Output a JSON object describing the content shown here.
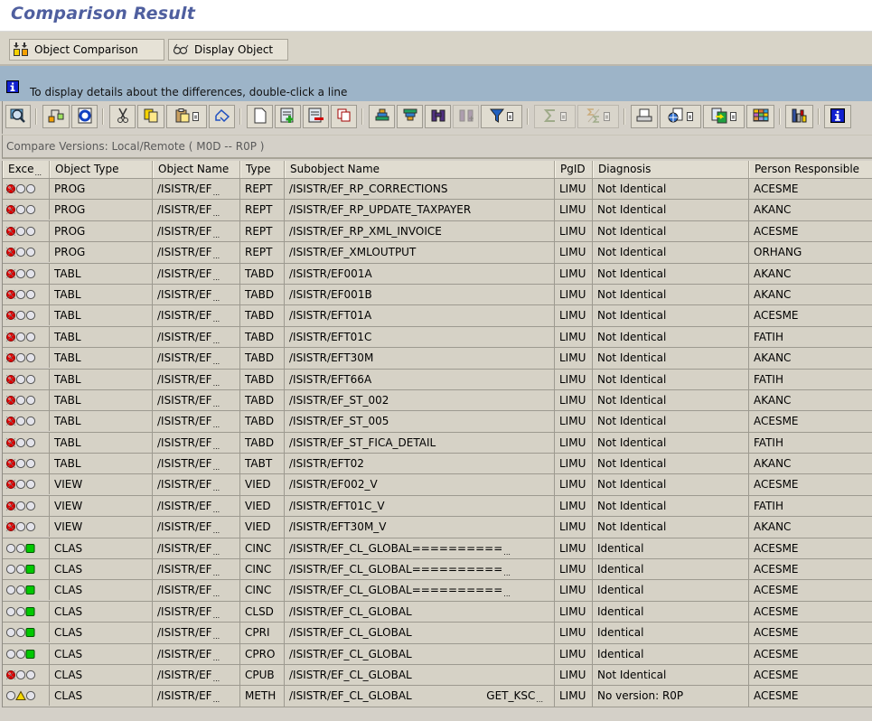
{
  "window": {
    "title": "Comparison Result"
  },
  "app_toolbar": {
    "buttons": [
      {
        "label": "Object Comparison",
        "icon": "object-comparison-icon"
      },
      {
        "label": "Display Object",
        "icon": "glasses-icon"
      }
    ]
  },
  "message": {
    "icon": "info-icon",
    "text": "To display details about the differences, double-click a line"
  },
  "alv_toolbar": {
    "buttons": [
      {
        "name": "details",
        "icon": "magnifier-icon",
        "enabled": true
      },
      {
        "name": "hierarchy",
        "icon": "hierarchy-icon",
        "enabled": true
      },
      {
        "name": "refresh",
        "icon": "refresh-icon",
        "enabled": true
      },
      {
        "name": "cut",
        "icon": "scissors-icon",
        "enabled": true
      },
      {
        "name": "copy",
        "icon": "copy-icon",
        "enabled": true
      },
      {
        "name": "paste",
        "icon": "paste-icon",
        "enabled": true,
        "menu": true
      },
      {
        "name": "undo",
        "icon": "undo-icon",
        "enabled": true
      },
      {
        "name": "new",
        "icon": "new-document-icon",
        "enabled": true
      },
      {
        "name": "insert-row",
        "icon": "insert-row-icon",
        "enabled": true
      },
      {
        "name": "delete-row",
        "icon": "delete-row-icon",
        "enabled": true
      },
      {
        "name": "duplicate-row",
        "icon": "duplicate-row-icon",
        "enabled": true
      },
      {
        "name": "sort-ascending",
        "icon": "sort-ascending-icon",
        "enabled": true
      },
      {
        "name": "sort-descending",
        "icon": "sort-descending-icon",
        "enabled": true
      },
      {
        "name": "find",
        "icon": "binoculars-icon",
        "enabled": true
      },
      {
        "name": "find-next",
        "icon": "binoculars-plus-icon",
        "enabled": false
      },
      {
        "name": "filter",
        "icon": "filter-icon",
        "enabled": true,
        "menu": true
      },
      {
        "name": "total",
        "icon": "sum-icon",
        "enabled": false,
        "menu": true
      },
      {
        "name": "subtotal",
        "icon": "subtotal-icon",
        "enabled": false,
        "menu": true
      },
      {
        "name": "print",
        "icon": "printer-icon",
        "enabled": true
      },
      {
        "name": "views",
        "icon": "views-icon",
        "enabled": true,
        "menu": true
      },
      {
        "name": "export",
        "icon": "export-icon",
        "enabled": true,
        "menu": true
      },
      {
        "name": "layout",
        "icon": "layout-grid-icon",
        "enabled": true
      },
      {
        "name": "graphic",
        "icon": "bar-chart-icon",
        "enabled": true
      },
      {
        "name": "info",
        "icon": "info-icon",
        "enabled": true
      }
    ]
  },
  "grid": {
    "subtitle": "Compare Versions: Local/Remote ( M0D -- R0P )",
    "columns": [
      "Exce",
      "Object Type",
      "Object Name",
      "Type",
      "Subobject Name",
      "PgID",
      "Diagnosis",
      "Person Responsible"
    ],
    "rows": [
      {
        "status": "red",
        "obj_type": "PROG",
        "obj_name": "/ISISTR/EF",
        "type": "REPT",
        "sub": "/ISISTR/EF_RP_CORRECTIONS",
        "pgid": "LIMU",
        "diag": "Not Identical",
        "person": "ACESME"
      },
      {
        "status": "red",
        "obj_type": "PROG",
        "obj_name": "/ISISTR/EF",
        "type": "REPT",
        "sub": "/ISISTR/EF_RP_UPDATE_TAXPAYER",
        "pgid": "LIMU",
        "diag": "Not Identical",
        "person": "AKANC"
      },
      {
        "status": "red",
        "obj_type": "PROG",
        "obj_name": "/ISISTR/EF",
        "type": "REPT",
        "sub": "/ISISTR/EF_RP_XML_INVOICE",
        "pgid": "LIMU",
        "diag": "Not Identical",
        "person": "ACESME"
      },
      {
        "status": "red",
        "obj_type": "PROG",
        "obj_name": "/ISISTR/EF",
        "type": "REPT",
        "sub": "/ISISTR/EF_XMLOUTPUT",
        "pgid": "LIMU",
        "diag": "Not Identical",
        "person": "ORHANG"
      },
      {
        "status": "red",
        "obj_type": "TABL",
        "obj_name": "/ISISTR/EF",
        "type": "TABD",
        "sub": "/ISISTR/EF001A",
        "pgid": "LIMU",
        "diag": "Not Identical",
        "person": "AKANC"
      },
      {
        "status": "red",
        "obj_type": "TABL",
        "obj_name": "/ISISTR/EF",
        "type": "TABD",
        "sub": "/ISISTR/EF001B",
        "pgid": "LIMU",
        "diag": "Not Identical",
        "person": "AKANC"
      },
      {
        "status": "red",
        "obj_type": "TABL",
        "obj_name": "/ISISTR/EF",
        "type": "TABD",
        "sub": "/ISISTR/EFT01A",
        "pgid": "LIMU",
        "diag": "Not Identical",
        "person": "ACESME"
      },
      {
        "status": "red",
        "obj_type": "TABL",
        "obj_name": "/ISISTR/EF",
        "type": "TABD",
        "sub": "/ISISTR/EFT01C",
        "pgid": "LIMU",
        "diag": "Not Identical",
        "person": "FATIH"
      },
      {
        "status": "red",
        "obj_type": "TABL",
        "obj_name": "/ISISTR/EF",
        "type": "TABD",
        "sub": "/ISISTR/EFT30M",
        "pgid": "LIMU",
        "diag": "Not Identical",
        "person": "AKANC"
      },
      {
        "status": "red",
        "obj_type": "TABL",
        "obj_name": "/ISISTR/EF",
        "type": "TABD",
        "sub": "/ISISTR/EFT66A",
        "pgid": "LIMU",
        "diag": "Not Identical",
        "person": "FATIH"
      },
      {
        "status": "red",
        "obj_type": "TABL",
        "obj_name": "/ISISTR/EF",
        "type": "TABD",
        "sub": "/ISISTR/EF_ST_002",
        "pgid": "LIMU",
        "diag": "Not Identical",
        "person": "AKANC"
      },
      {
        "status": "red",
        "obj_type": "TABL",
        "obj_name": "/ISISTR/EF",
        "type": "TABD",
        "sub": "/ISISTR/EF_ST_005",
        "pgid": "LIMU",
        "diag": "Not Identical",
        "person": "ACESME"
      },
      {
        "status": "red",
        "obj_type": "TABL",
        "obj_name": "/ISISTR/EF",
        "type": "TABD",
        "sub": "/ISISTR/EF_ST_FICA_DETAIL",
        "pgid": "LIMU",
        "diag": "Not Identical",
        "person": "FATIH"
      },
      {
        "status": "red",
        "obj_type": "TABL",
        "obj_name": "/ISISTR/EF",
        "type": "TABT",
        "sub": "/ISISTR/EFT02",
        "pgid": "LIMU",
        "diag": "Not Identical",
        "person": "AKANC"
      },
      {
        "status": "red",
        "obj_type": "VIEW",
        "obj_name": "/ISISTR/EF",
        "type": "VIED",
        "sub": "/ISISTR/EF002_V",
        "pgid": "LIMU",
        "diag": "Not Identical",
        "person": "ACESME"
      },
      {
        "status": "red",
        "obj_type": "VIEW",
        "obj_name": "/ISISTR/EF",
        "type": "VIED",
        "sub": "/ISISTR/EFT01C_V",
        "pgid": "LIMU",
        "diag": "Not Identical",
        "person": "FATIH"
      },
      {
        "status": "red",
        "obj_type": "VIEW",
        "obj_name": "/ISISTR/EF",
        "type": "VIED",
        "sub": "/ISISTR/EFT30M_V",
        "pgid": "LIMU",
        "diag": "Not Identical",
        "person": "AKANC"
      },
      {
        "status": "green",
        "obj_type": "CLAS",
        "obj_name": "/ISISTR/EF",
        "type": "CINC",
        "sub": "/ISISTR/EF_CL_GLOBAL==========",
        "sub_trunc": true,
        "pgid": "LIMU",
        "diag": "Identical",
        "person": "ACESME"
      },
      {
        "status": "green",
        "obj_type": "CLAS",
        "obj_name": "/ISISTR/EF",
        "type": "CINC",
        "sub": "/ISISTR/EF_CL_GLOBAL==========",
        "sub_trunc": true,
        "pgid": "LIMU",
        "diag": "Identical",
        "person": "ACESME"
      },
      {
        "status": "green",
        "obj_type": "CLAS",
        "obj_name": "/ISISTR/EF",
        "type": "CINC",
        "sub": "/ISISTR/EF_CL_GLOBAL==========",
        "sub_trunc": true,
        "pgid": "LIMU",
        "diag": "Identical",
        "person": "ACESME"
      },
      {
        "status": "green",
        "obj_type": "CLAS",
        "obj_name": "/ISISTR/EF",
        "type": "CLSD",
        "sub": "/ISISTR/EF_CL_GLOBAL",
        "pgid": "LIMU",
        "diag": "Identical",
        "person": "ACESME"
      },
      {
        "status": "green",
        "obj_type": "CLAS",
        "obj_name": "/ISISTR/EF",
        "type": "CPRI",
        "sub": "/ISISTR/EF_CL_GLOBAL",
        "pgid": "LIMU",
        "diag": "Identical",
        "person": "ACESME"
      },
      {
        "status": "green",
        "obj_type": "CLAS",
        "obj_name": "/ISISTR/EF",
        "type": "CPRO",
        "sub": "/ISISTR/EF_CL_GLOBAL",
        "pgid": "LIMU",
        "diag": "Identical",
        "person": "ACESME"
      },
      {
        "status": "red",
        "obj_type": "CLAS",
        "obj_name": "/ISISTR/EF",
        "type": "CPUB",
        "sub": "/ISISTR/EF_CL_GLOBAL",
        "pgid": "LIMU",
        "diag": "Not Identical",
        "person": "ACESME"
      },
      {
        "status": "yellow",
        "obj_type": "CLAS",
        "obj_name": "/ISISTR/EF",
        "type": "METH",
        "sub": "/ISISTR/EF_CL_GLOBAL",
        "sub_right": "GET_KSC",
        "pgid": "LIMU",
        "diag": "No version: R0P",
        "person": "ACESME"
      }
    ]
  },
  "colors": {
    "red": "#e00000",
    "yellow": "#f5d800",
    "green": "#00c800",
    "title": "#4f5f9f",
    "message_bar": "#9db4c8"
  }
}
